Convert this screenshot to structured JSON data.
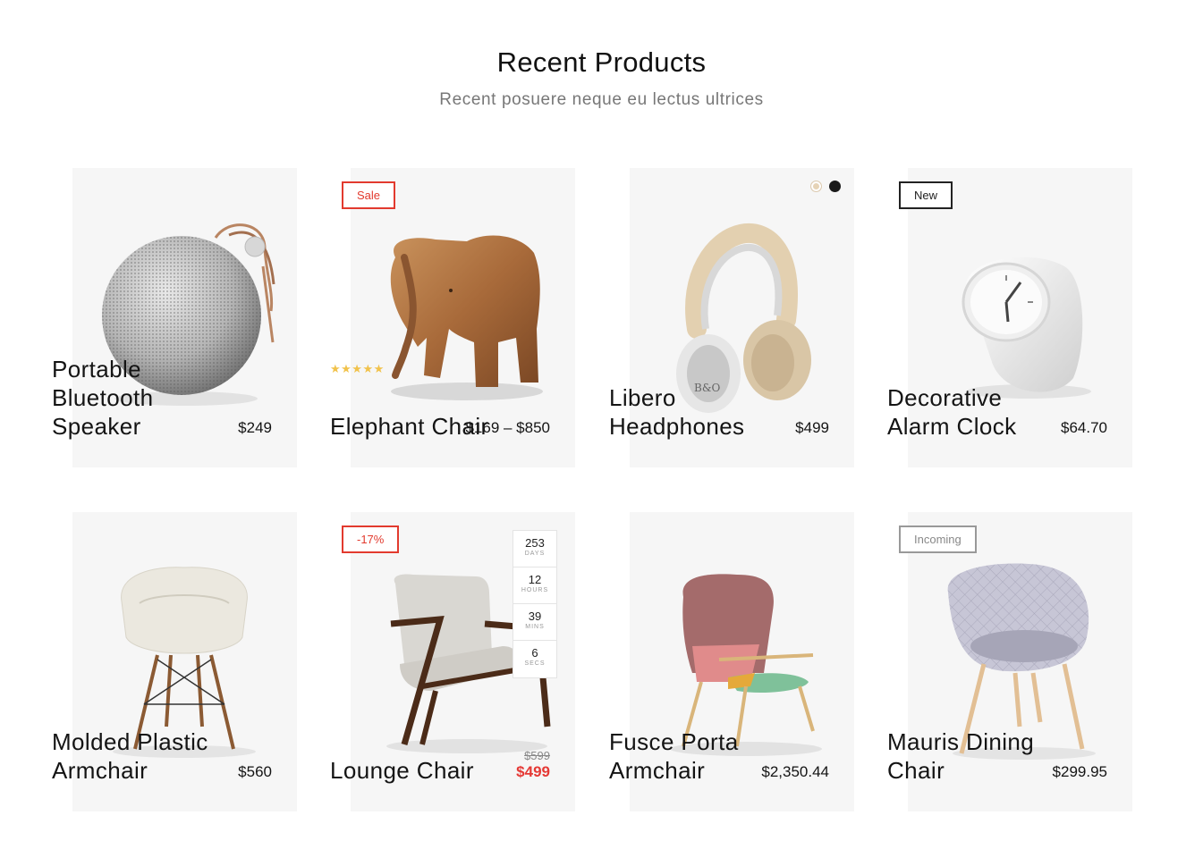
{
  "section": {
    "title": "Recent Products",
    "subtitle": "Recent posuere neque eu lectus ultrices"
  },
  "products": [
    {
      "name": "Portable Bluetooth Speaker",
      "price": "$249",
      "image": "speaker"
    },
    {
      "name": "Elephant Chair",
      "price": "$169 – $850",
      "badge": "Sale",
      "rating": 5,
      "image": "wooden-elephant"
    },
    {
      "name": "Libero Headphones",
      "price": "$499",
      "swatches": [
        "#e6d3b6",
        "#1a1a1a"
      ],
      "image": "headphones"
    },
    {
      "name": "Decorative Alarm Clock",
      "price": "$64.70",
      "badge": "New",
      "image": "alarm-clock"
    },
    {
      "name": "Molded Plastic Armchair",
      "price": "$560",
      "image": "plastic-armchair"
    },
    {
      "name": "Lounge Chair",
      "price_old": "$599",
      "price": "$499",
      "badge": "-17%",
      "image": "lounge-chair",
      "countdown": {
        "days": "253",
        "hours": "12",
        "mins": "39",
        "secs": "6",
        "days_label": "DAYS",
        "hours_label": "HOURS",
        "mins_label": "MINS",
        "secs_label": "SECS"
      }
    },
    {
      "name": "Fusce Porta Armchair",
      "price": "$2,350.44",
      "image": "wing-armchair"
    },
    {
      "name": "Mauris Dining Chair",
      "price": "$299.95",
      "badge": "Incoming",
      "image": "dining-chair"
    }
  ],
  "colors": {
    "sale": "#e23a2e",
    "star": "#f1c24b",
    "card_bg": "#f6f6f6"
  }
}
